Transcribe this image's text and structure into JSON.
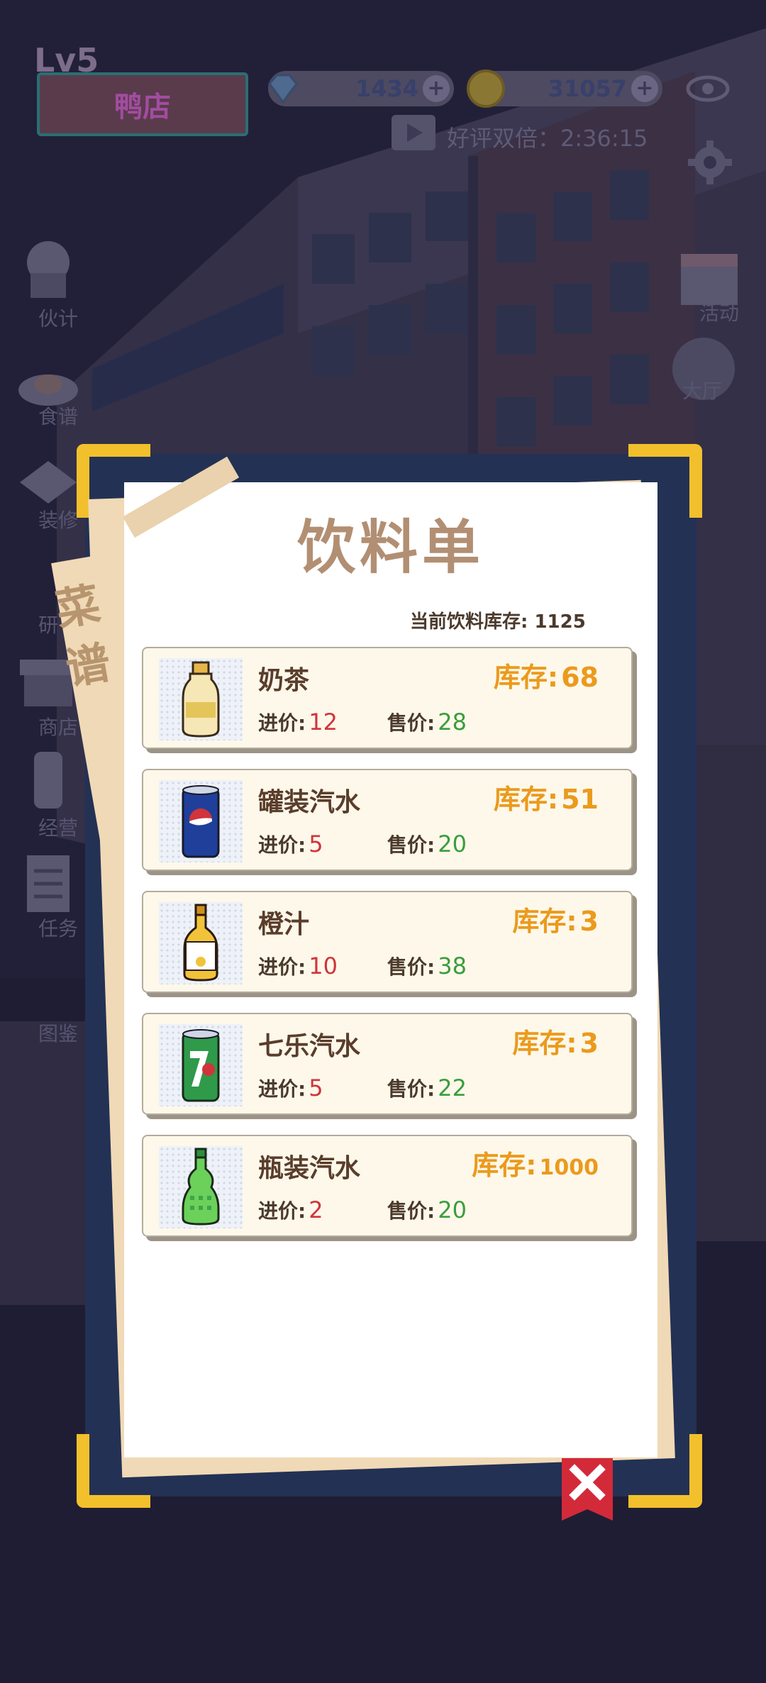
{
  "hud": {
    "level": "Lv5",
    "shop_name": "鸭店",
    "diamonds": "1434",
    "coins": "31057",
    "double_text": "好评双倍：2:36:15"
  },
  "side_menu": {
    "left": [
      "伙计",
      "食谱",
      "装修",
      "研",
      "商店",
      "经营",
      "任务",
      "图鉴"
    ],
    "right": [
      "活动",
      "大厅"
    ]
  },
  "modal": {
    "tab_label": "菜谱",
    "title": "饮料单",
    "total_stock": "当前饮料库存: 1125",
    "stock_prefix": "库存:",
    "buy_prefix": "进价:",
    "sell_prefix": "售价:",
    "items": [
      {
        "name": "奶茶",
        "stock": "68",
        "buy": "12",
        "sell": "28",
        "icon": "milk-tea-bottle-icon"
      },
      {
        "name": "罐装汽水",
        "stock": "51",
        "buy": "5",
        "sell": "20",
        "icon": "soda-can-icon"
      },
      {
        "name": "橙汁",
        "stock": "3",
        "buy": "10",
        "sell": "38",
        "icon": "orange-juice-bottle-icon"
      },
      {
        "name": "七乐汽水",
        "stock": "3",
        "buy": "5",
        "sell": "22",
        "icon": "seven-up-can-icon"
      },
      {
        "name": "瓶装汽水",
        "stock": "1000",
        "buy": "2",
        "sell": "20",
        "icon": "green-soda-bottle-icon"
      }
    ]
  },
  "colors": {
    "frame": "#233154",
    "corner": "#f2c02c",
    "title": "#b28f73",
    "stock": "#eb9a1d",
    "buy": "#d1343b",
    "sell": "#3b9d3d",
    "close": "#d32a3a"
  }
}
